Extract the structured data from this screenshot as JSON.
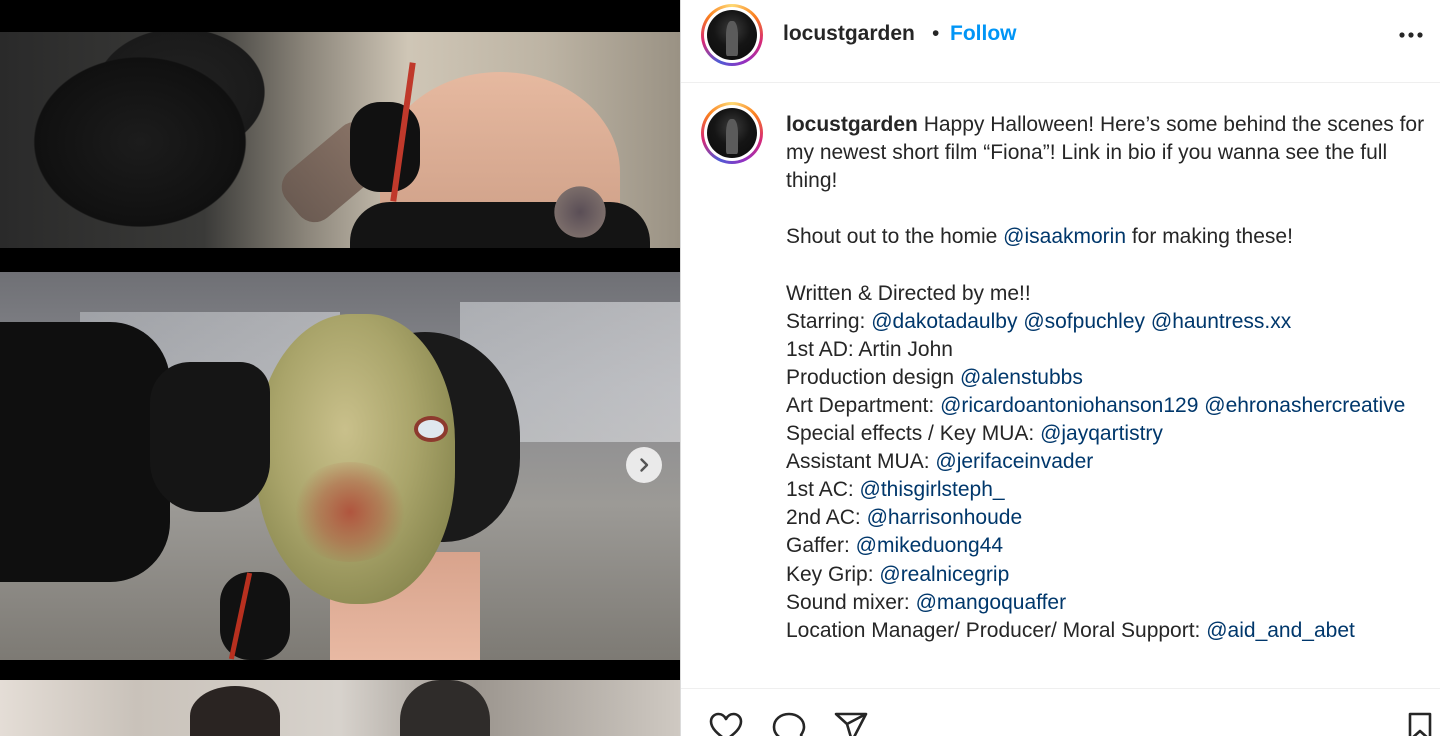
{
  "post": {
    "author": "locustgarden",
    "separator": "•",
    "follow_label": "Follow",
    "more_icon": "more-options-icon",
    "next_icon": "chevron-right-icon"
  },
  "caption": {
    "username": "locustgarden",
    "lines": [
      [
        {
          "t": " Happy Halloween! Here’s some behind the scenes for my newest short film “Fiona”! Link in bio if you wanna see the full thing!"
        }
      ],
      [
        {
          "t": ""
        }
      ],
      [
        {
          "t": "Shout out to the homie "
        },
        {
          "m": "@isaakmorin"
        },
        {
          "t": " for making these!"
        }
      ],
      [
        {
          "t": ""
        }
      ],
      [
        {
          "t": "Written & Directed by me!!"
        }
      ],
      [
        {
          "t": "Starring: "
        },
        {
          "m": "@dakotadaulby"
        },
        {
          "t": " "
        },
        {
          "m": "@sofpuchley"
        },
        {
          "t": " "
        },
        {
          "m": "@hauntress.xx"
        }
      ],
      [
        {
          "t": "1st AD: Artin John"
        }
      ],
      [
        {
          "t": "Production design "
        },
        {
          "m": "@alenstubbs"
        }
      ],
      [
        {
          "t": "Art Department: "
        },
        {
          "m": "@ricardoantoniohanson129"
        },
        {
          "t": " "
        },
        {
          "m": "@ehronashercreative"
        }
      ],
      [
        {
          "t": "Special effects / Key MUA: "
        },
        {
          "m": "@jayqartistry"
        }
      ],
      [
        {
          "t": "Assistant MUA: "
        },
        {
          "m": "@jerifaceinvader"
        }
      ],
      [
        {
          "t": "1st AC: "
        },
        {
          "m": "@thisgirlsteph_"
        }
      ],
      [
        {
          "t": "2nd AC: "
        },
        {
          "m": "@harrisonhoude"
        }
      ],
      [
        {
          "t": "Gaffer: "
        },
        {
          "m": "@mikeduong44"
        }
      ],
      [
        {
          "t": "Key Grip: "
        },
        {
          "m": "@realnicegrip"
        }
      ],
      [
        {
          "t": "Sound mixer: "
        },
        {
          "m": "@mangoquaffer"
        }
      ],
      [
        {
          "t": "Location Manager/ Producer/ Moral Support: "
        },
        {
          "m": "@aid_and_abet"
        }
      ]
    ]
  },
  "actions": {
    "like_icon": "heart-icon",
    "comment_icon": "comment-icon",
    "share_icon": "send-icon",
    "save_icon": "bookmark-icon"
  },
  "colors": {
    "link": "#0095f6",
    "mention": "#00376b",
    "text": "#262626"
  }
}
